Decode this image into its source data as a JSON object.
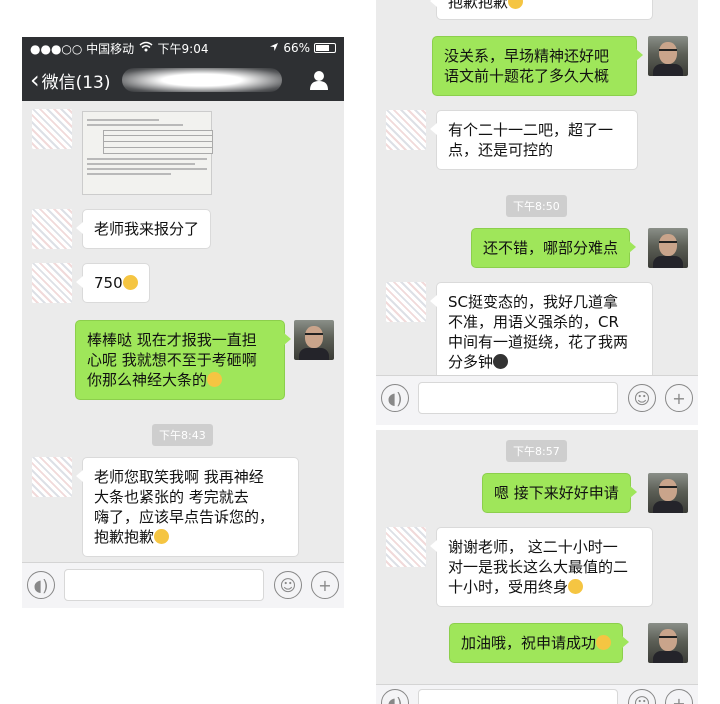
{
  "status": {
    "carrier": "●●●○○ 中国移动",
    "time": "下午9:04",
    "battery": "66%"
  },
  "nav": {
    "back_label": "微信(13)"
  },
  "panel1": {
    "msgs": [
      "老师我来报分了",
      "750",
      "棒棒哒 现在才报我一直担\n心呢 我就想不至于考砸啊\n你那么神经大条的",
      "老师您取笑我啊 我再神经\n大条也紧张的 考完就去\n嗨了，应该早点告诉您的，\n抱歉抱歉"
    ],
    "time": "下午8:43"
  },
  "panel2": {
    "top_fragment": "抱歉抱歉",
    "msgs": [
      "没关系，早场精神还好吧\n语文前十题花了多久大概",
      "有个二十一二吧，超了一\n点，还是可控的",
      "还不错，哪部分难点",
      "SC挺变态的，我好几道拿\n不准，用语义强杀的，CR\n中间有一道挺绕，花了我两\n分多钟"
    ],
    "time": "下午8:50"
  },
  "panel3": {
    "msgs": [
      "嗯 接下来好好申请",
      "谢谢老师， 这二十小时一\n对一是我长这么大最值的二\n十小时，受用终身",
      "加油哦，祝申请成功"
    ],
    "time": "下午8:57"
  },
  "colors": {
    "bubble_green": "#9fe65a",
    "navbar": "#2e3033",
    "chat_bg": "#ebebeb"
  },
  "icons": [
    "wifi-icon",
    "location-arrow-icon",
    "battery-icon",
    "back-chevron-icon",
    "contact-icon",
    "voice-icon",
    "emoji-icon",
    "plus-icon"
  ]
}
